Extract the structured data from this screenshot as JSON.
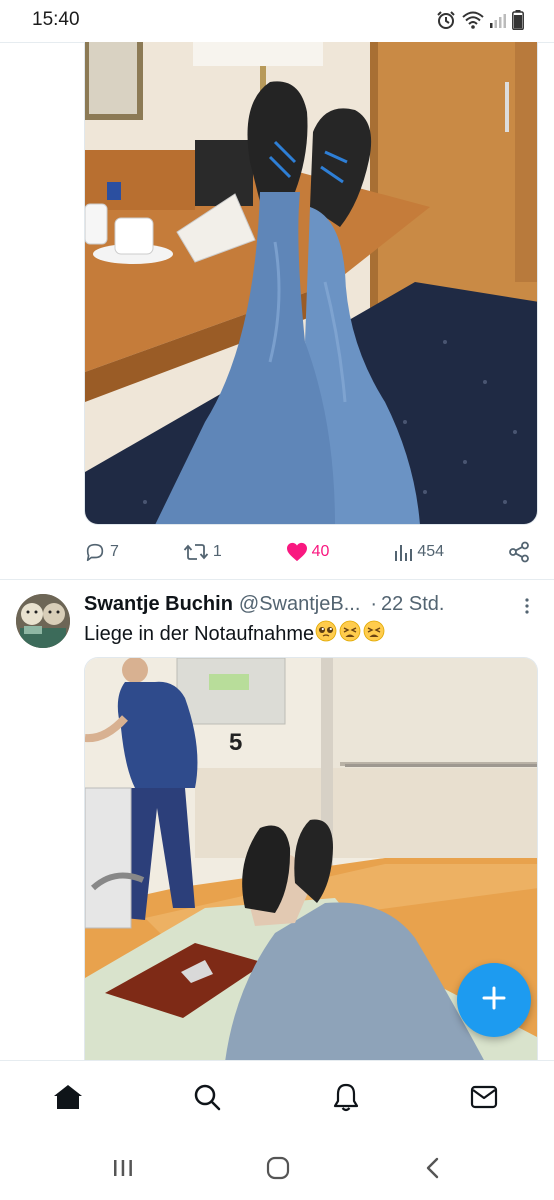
{
  "status_bar": {
    "time": "15:40",
    "icons": [
      "alarm-icon",
      "wifi-icon",
      "signal-icon",
      "battery-icon"
    ]
  },
  "tweet_1": {
    "image_description_icon": "photo",
    "actions": {
      "replies": "7",
      "retweets": "1",
      "likes": "40",
      "views": "454",
      "liked": true
    }
  },
  "tweet_2": {
    "display_name": "Swantje Buchin",
    "handle": "@SwantjeB...",
    "separator": "·",
    "time_ago": "22 Std.",
    "text": "Liege in der Notaufnahme",
    "emojis": [
      "pleading-face",
      "tired-face",
      "tired-face"
    ],
    "photo_sign_text": "5"
  },
  "fab": {
    "icon": "plus-icon"
  },
  "bottom_nav": {
    "items": [
      "home-icon",
      "search-icon",
      "notifications-icon",
      "messages-icon"
    ],
    "active": "home-icon"
  },
  "system_nav": {
    "items": [
      "recent-apps-icon",
      "home-circle-icon",
      "back-icon"
    ]
  },
  "colors": {
    "accent": "#1d9bf0",
    "like": "#f91880",
    "muted": "#536471",
    "text": "#0f1419"
  }
}
